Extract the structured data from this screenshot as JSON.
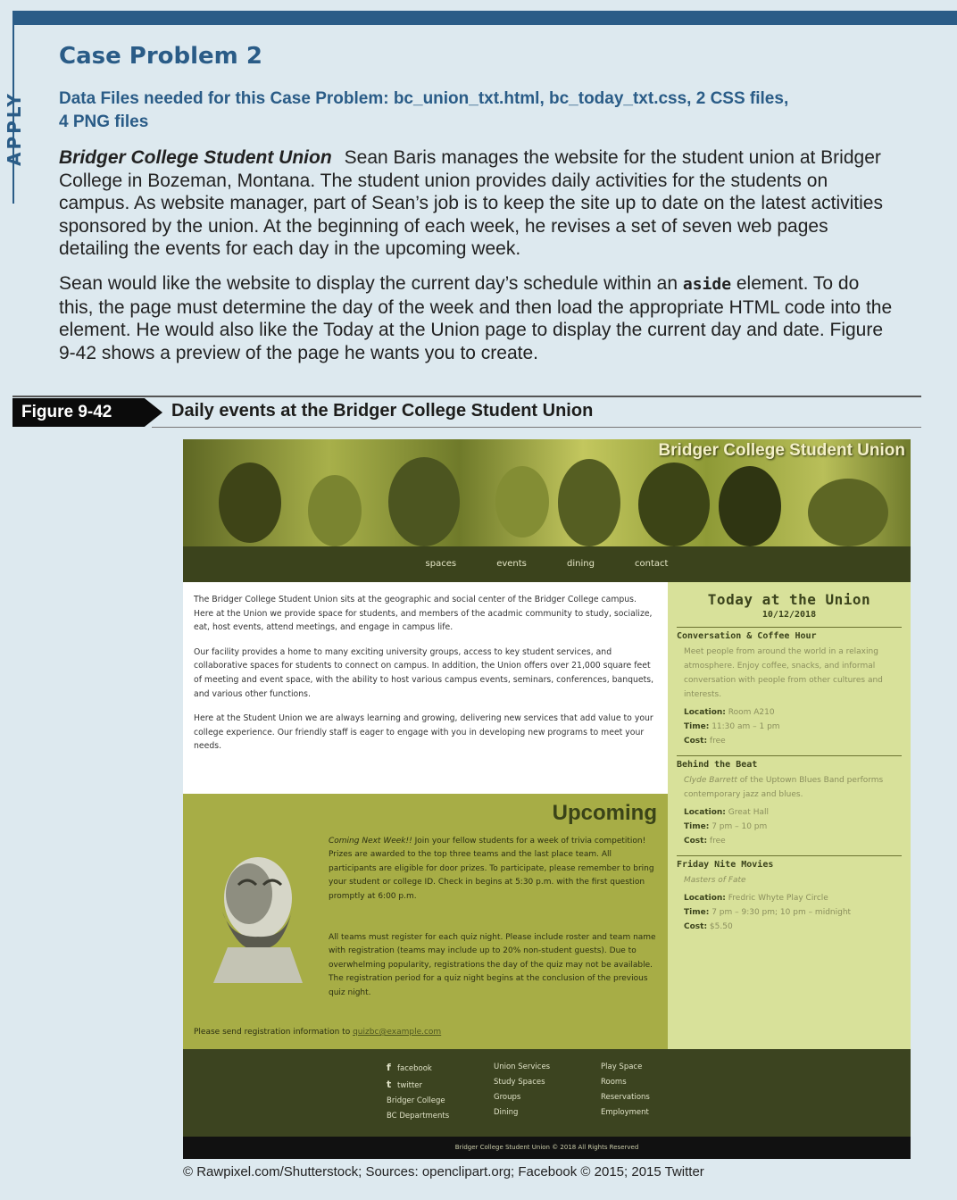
{
  "sidebar": {
    "label": "APPLY"
  },
  "heading": {
    "title": "Case Problem 2",
    "data_files_line1": "Data Files needed for this Case Problem: bc_union_txt.html, bc_today_txt.css, 2 CSS files,",
    "data_files_line2": "4 PNG files"
  },
  "body": {
    "lead": "Bridger College Student Union",
    "para1": "Sean Baris manages the website for the student union at Bridger College in Bozeman, Montana. The student union provides daily activities for the students on campus. As website manager, part of Sean’s job is to keep the site up to date on the latest activities sponsored by the union. At the beginning of each week, he revises a set of seven web pages detailing the events for each day in the upcoming week.",
    "para2_a": "Sean would like the website to display the current day’s schedule within an ",
    "para2_code": "aside",
    "para2_b": " element. To do this, the page must determine the day of the week and then load the appropriate HTML code into the element. He would also like the Today at the Union page to display the current day and date. Figure 9-42 shows a preview of the page he wants you to create."
  },
  "figure": {
    "number": "Figure 9-42",
    "caption": "Daily events at the Bridger College Student Union",
    "credit": "© Rawpixel.com/Shutterstock; Sources: openclipart.org; Facebook © 2015; 2015 Twitter"
  },
  "site": {
    "name": "Bridger College Student Union",
    "nav": [
      "spaces",
      "events",
      "dining",
      "contact"
    ],
    "intro": [
      "The Bridger College Student Union sits at the geographic and social center of the Bridger College campus. Here at the Union we provide space for students, and members of the acadmic community to study, socialize, eat, host events, attend meetings, and engage in campus life.",
      "Our facility provides a home to many exciting university groups, access to key student services, and collaborative spaces for students to connect on campus. In addition, the Union offers over 21,000 square feet of meeting and event space, with the ability to host various campus events, seminars, conferences, banquets, and various other functions.",
      "Here at the Student Union we are always learning and growing, delivering new services that add value to your college experience. Our friendly staff is eager to engage with you in developing new programs to meet your needs."
    ],
    "upcoming": {
      "title": "Upcoming",
      "p1_em": "Coming Next Week!!",
      "p1": " Join your fellow students for a week of trivia competition! Prizes are awarded to the top three teams and the last place team. All participants are eligible for door prizes. To participate, please remember to bring your student or college ID. Check in begins at 5:30 p.m. with the first question promptly at 6:00 p.m.",
      "p2": "All teams must register for each quiz night. Please include roster and team name with registration (teams may include up to 20% non-student guests). Due to overwhelming popularity, registrations the day of the quiz may not be available. The registration period for a quiz night begins at the conclusion of the previous quiz night.",
      "p3": "Please send registration information to ",
      "email": "quizbc@example.com"
    },
    "today": {
      "title": "Today at the Union",
      "date": "10/12/2018",
      "events": [
        {
          "name": "Conversation & Coffee Hour",
          "desc": "Meet people from around the world in a relaxing atmosphere. Enjoy coffee, snacks, and informal conversation with people from other cultures and interests.",
          "location": "Room A210",
          "time": "11:30 am – 1 pm",
          "cost": "free"
        },
        {
          "name": "Behind the Beat",
          "desc_em": "Clyde Barrett",
          "desc": " of the Uptown Blues Band performs contemporary jazz and blues.",
          "location": "Great Hall",
          "time": "7 pm – 10 pm",
          "cost": "free"
        },
        {
          "name": "Friday Nite Movies",
          "desc_em": "Masters of Fate",
          "desc": "",
          "location": "Fredric Whyte Play Circle",
          "time": "7 pm – 9:30 pm; 10 pm – midnight",
          "cost": "$5.50"
        }
      ],
      "labels": {
        "location": "Location:",
        "time": "Time:",
        "cost": "Cost:"
      }
    },
    "footer": {
      "col1": [
        "facebook",
        "twitter",
        "Bridger College",
        "BC Departments"
      ],
      "col2": [
        "Union Services",
        "Study Spaces",
        "Groups",
        "Dining"
      ],
      "col3": [
        "Play Space",
        "Rooms",
        "Reservations",
        "Employment"
      ],
      "copyright": "Bridger College Student Union © 2018 All Rights Reserved"
    }
  }
}
